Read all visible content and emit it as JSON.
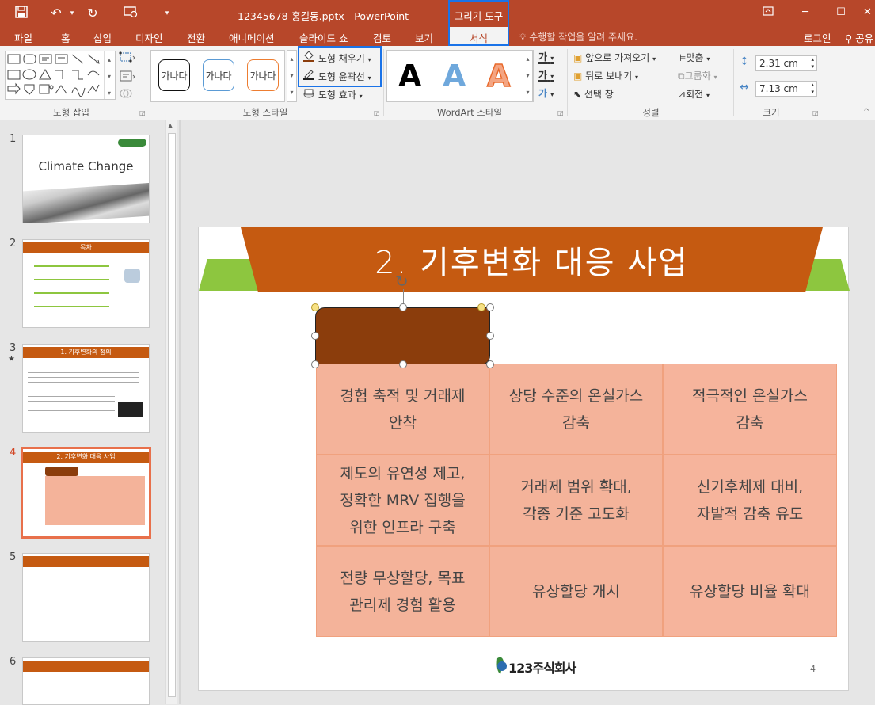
{
  "titlebar": {
    "title": "12345678-홍길동.pptx - PowerPoint",
    "contextual_tab_group": "그리기 도구"
  },
  "tabs": [
    "파일",
    "홈",
    "삽입",
    "디자인",
    "전환",
    "애니메이션",
    "슬라이드 쇼",
    "검토",
    "보기"
  ],
  "active_tab": "서식",
  "tell_me": "수행할 작업을 알려 주세요.",
  "login": "로그인",
  "share": "공유",
  "ribbon": {
    "groups": {
      "insert_shapes": "도형 삽입",
      "shape_styles": "도형 스타일",
      "wordart_styles": "WordArt 스타일",
      "arrange": "정렬",
      "size": "크기"
    },
    "style_samples": [
      "가나다",
      "가나다",
      "가나다"
    ],
    "shape_fill": "도형 채우기",
    "shape_outline": "도형 윤곽선",
    "shape_effects": "도형 효과",
    "wordart_sample": "A",
    "text_fill_glyph": "가",
    "text_outline_glyph": "가",
    "text_effect_glyph": "가",
    "bring_forward": "앞으로 가져오기",
    "send_backward": "뒤로 보내기",
    "selection_pane": "선택 창",
    "align": "맞춤",
    "group": "그룹화",
    "rotate": "회전",
    "height": "2.31 cm",
    "width": "7.13 cm"
  },
  "thumbnails": [
    {
      "num": "1",
      "title": "Climate Change"
    },
    {
      "num": "2",
      "title": "목차"
    },
    {
      "num": "3",
      "title": "1. 기후변화의 정의"
    },
    {
      "num": "4",
      "title": "2. 기후변화 대응 사업"
    },
    {
      "num": "5",
      "title": ""
    },
    {
      "num": "6",
      "title": ""
    }
  ],
  "slide": {
    "title": "2. 기후변화 대응 사업",
    "cells": [
      "경험 축적 및 거래제\n안착",
      "상당 수준의 온실가스\n감축",
      "적극적인 온실가스\n감축",
      "제도의 유연성 제고,\n정확한 MRV 집행을\n위한 인프라 구축",
      "거래제 범위 확대,\n각종 기준 고도화",
      "신기후체제 대비,\n자발적 감축 유도",
      "전량 무상할당, 목표\n관리제 경험 활용",
      "유상할당 개시",
      "유상할당 비율 확대"
    ],
    "logo_text": "123주식회사",
    "page_number": "4"
  }
}
